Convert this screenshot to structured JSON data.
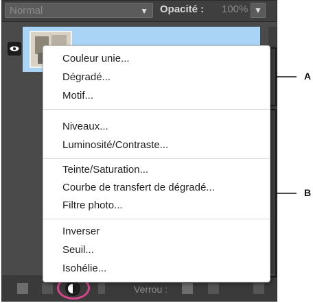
{
  "toolbar": {
    "blend_mode": "Normal",
    "opacity_label": "Opacité :",
    "opacity_value": "100%"
  },
  "menu": {
    "groups": [
      [
        "Couleur unie...",
        "Dégradé...",
        "Motif..."
      ],
      [
        "Niveaux...",
        "Luminosité/Contraste..."
      ],
      [
        "Teinte/Saturation...",
        "Courbe de transfert de dégradé...",
        "Filtre photo..."
      ],
      [
        "Inverser",
        "Seuil...",
        "Isohélie..."
      ]
    ]
  },
  "bottom_bar": {
    "lock_label": "Verrou :"
  },
  "callouts": {
    "a": "A",
    "b": "B"
  },
  "colors": {
    "panel_bg": "#4a4a4a",
    "layer_selected": "#a9d4f5",
    "highlight_circle": "#d4468a"
  },
  "icons": [
    "eye-icon",
    "chevron-down-icon",
    "new-layer-icon",
    "link-icon",
    "adjustment-layer-icon",
    "lock-transparency-icon",
    "lock-all-icon",
    "trash-icon"
  ]
}
